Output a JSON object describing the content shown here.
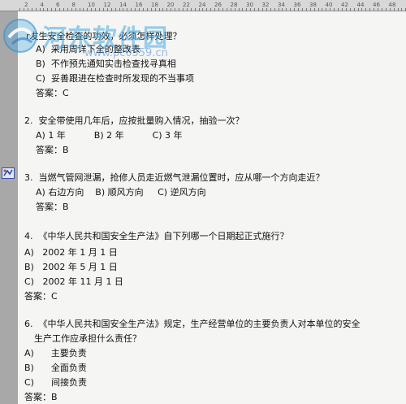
{
  "ruler": {
    "labels": [
      "2",
      "4",
      "6",
      "8",
      "10",
      "12",
      "14",
      "16",
      "18",
      "20",
      "22",
      "24",
      "26",
      "28",
      "30",
      "32",
      "34",
      "36",
      "38",
      "40",
      "42",
      "44",
      "46",
      "48"
    ]
  },
  "watermark": {
    "text": "河东软件园",
    "url": "www.pc0359.cn"
  },
  "questions": [
    {
      "lines": [
        "r发生安全检查的功效，必须怎样处理？",
        "A)  采用周详下全的整改表",
        "B)  不作预先通知实击检查找寻真相",
        "C)  妥善跟进在检查时所发现的不当事项"
      ],
      "answer": "答案：C"
    },
    {
      "lines": [
        "2.  安全带使用几年后，应按批量购入情况，抽验一次？",
        "A) 1 年          B) 2 年          C) 3 年"
      ],
      "answer": "答案：B"
    },
    {
      "lines": [
        "3.  当燃气管网泄漏，抢修人员走近燃气泄漏位置时，应从哪一个方向走近？",
        "A) 右边方向    B) 顺风方向     C) 逆风方向"
      ],
      "answer": "答案：B"
    },
    {
      "lines": [
        "4.  《中华人民共和国安全生产法》自下列哪一个日期起正式施行？",
        "A)   2002 年 1 月 1 日",
        "B)   2002 年 5 月 1 日",
        "C)   2002 年 11 月 1 日"
      ],
      "answer": "答案：C"
    },
    {
      "lines": [
        "6.  《中华人民共和国安全生产法》规定，生产经营单位的主要负责人对本单位的安全",
        "生产工作应承担什么责任？",
        "A)      主要负责",
        "B)      全面负责",
        "C)      间接负责"
      ],
      "answer": "答案：B"
    }
  ]
}
